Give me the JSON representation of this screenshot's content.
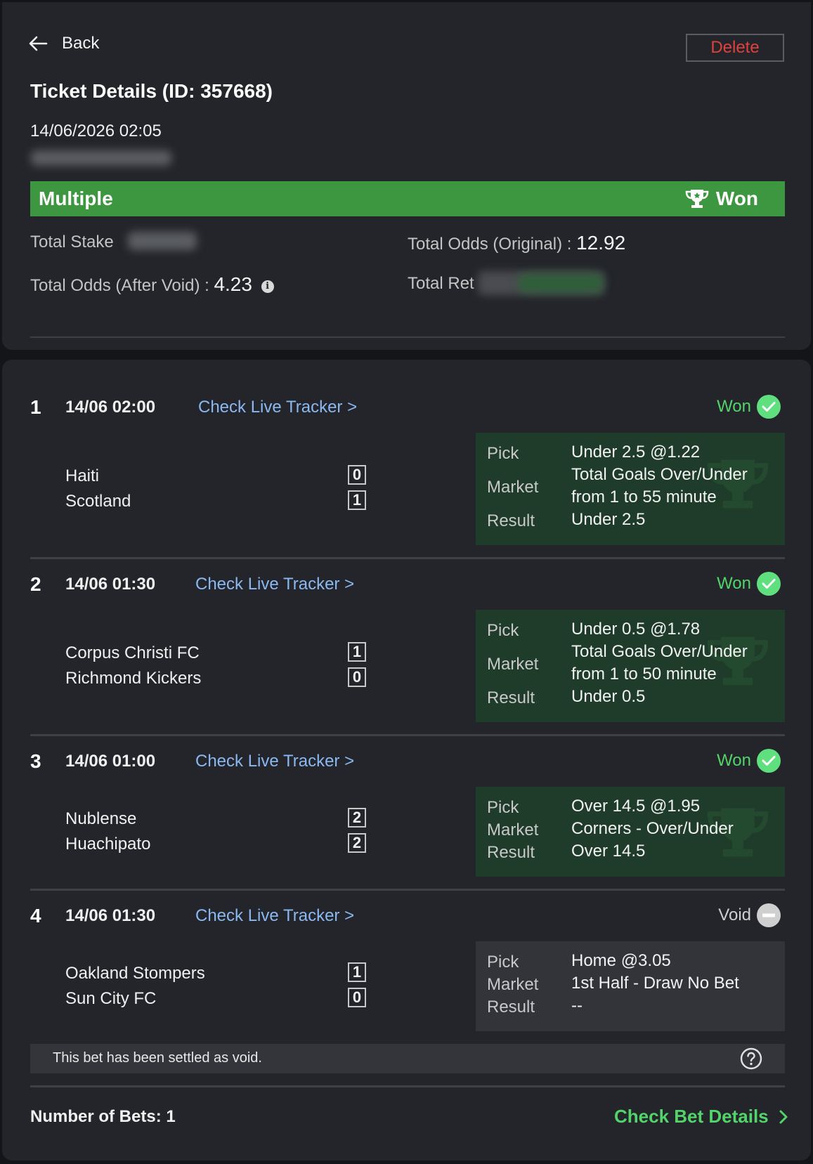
{
  "header": {
    "back_label": "Back",
    "delete_label": "Delete",
    "title": "Ticket Details (ID: 357668)",
    "datetime": "14/06/2026 02:05"
  },
  "banner": {
    "type": "Multiple",
    "status": "Won",
    "status_icon": "trophy-icon",
    "color": "#3d9640"
  },
  "summary": {
    "total_stake_label": "Total Stake",
    "total_odds_original_label": "Total Odds (Original) :",
    "total_odds_original_value": "12.92",
    "total_odds_after_void_label": "Total Odds (After Void) :",
    "total_odds_after_void_value": "4.23",
    "total_return_label": "Total Ret"
  },
  "legs": [
    {
      "num": "1",
      "time": "14/06 02:00",
      "tracker_label": "Check Live Tracker >",
      "status": "Won",
      "status_kind": "won",
      "home": "Haiti",
      "away": "Scotland",
      "home_score": "0",
      "away_score": "1",
      "pick_label": "Pick",
      "market_label": "Market",
      "result_label": "Result",
      "pick": "Under 2.5 @1.22",
      "market_line1": "Total Goals Over/Under",
      "market_line2": "from 1 to 55 minute",
      "result": "Under 2.5"
    },
    {
      "num": "2",
      "time": "14/06 01:30",
      "tracker_label": "Check Live Tracker >",
      "status": "Won",
      "status_kind": "won",
      "home": "Corpus Christi FC",
      "away": "Richmond Kickers",
      "home_score": "1",
      "away_score": "0",
      "pick_label": "Pick",
      "market_label": "Market",
      "result_label": "Result",
      "pick": "Under 0.5 @1.78",
      "market_line1": "Total Goals Over/Under",
      "market_line2": "from 1 to 50 minute",
      "result": "Under 0.5"
    },
    {
      "num": "3",
      "time": "14/06 01:00",
      "tracker_label": "Check Live Tracker >",
      "status": "Won",
      "status_kind": "won",
      "home": "Nublense",
      "away": "Huachipato",
      "home_score": "2",
      "away_score": "2",
      "pick_label": "Pick",
      "market_label": "Market",
      "result_label": "Result",
      "pick": "Over 14.5 @1.95",
      "market_line1": "Corners - Over/Under",
      "result": "Over 14.5"
    },
    {
      "num": "4",
      "time": "14/06 01:30",
      "tracker_label": "Check Live Tracker >",
      "status": "Void",
      "status_kind": "void",
      "home": "Oakland Stompers",
      "away": "Sun City FC",
      "home_score": "1",
      "away_score": "0",
      "pick_label": "Pick",
      "market_label": "Market",
      "result_label": "Result",
      "pick": "Home @3.05",
      "market_line1": "1st Half - Draw No Bet",
      "result": "--"
    }
  ],
  "void_note": "This bet has been settled as void.",
  "footer": {
    "number_of_bets": "Number of Bets: 1",
    "check_bet_details": "Check Bet Details"
  },
  "colors": {
    "won_green": "#52d46a",
    "tracker_blue": "#8ab8f0",
    "delete_red": "#e0413c",
    "won_box": "#1f3c2b"
  }
}
